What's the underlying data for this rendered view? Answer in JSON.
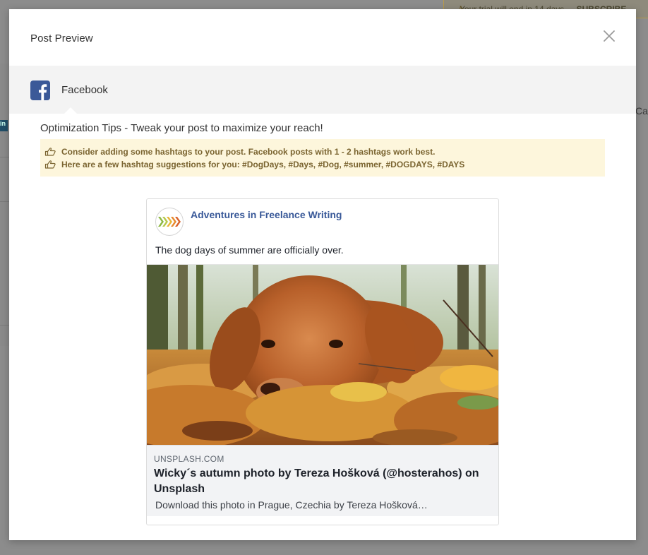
{
  "background": {
    "trial_banner_text": "Your trial will end in 14 days.",
    "trial_banner_action": "SUBSCRIBE",
    "side_label": "Cat"
  },
  "modal": {
    "title": "Post Preview",
    "network": {
      "name": "Facebook",
      "icon": "facebook-icon",
      "brand_color": "#3b5998"
    },
    "optimization": {
      "heading": "Optimization Tips - Tweak your post to maximize your reach!",
      "tips": [
        "Consider adding some hashtags to your post. Facebook posts with 1 - 2 hashtags work best.",
        "Here are a few hashtag suggestions for you: #DogDays, #Days, #Dog, #summer, #DOGDAYS, #DAYS"
      ],
      "tip_icon": "thumbs-up-icon",
      "box_color": "#fdf6dc"
    },
    "preview": {
      "page_name": "Adventures in Freelance Writing",
      "post_text": "The dog days of summer are officially over.",
      "link": {
        "domain": "UNSPLASH.COM",
        "title": "Wicky´s autumn photo by Tereza Hošková (@hosterahos) on Unsplash",
        "description": "Download this photo in Prague, Czechia by Tereza Hošková…"
      }
    }
  }
}
